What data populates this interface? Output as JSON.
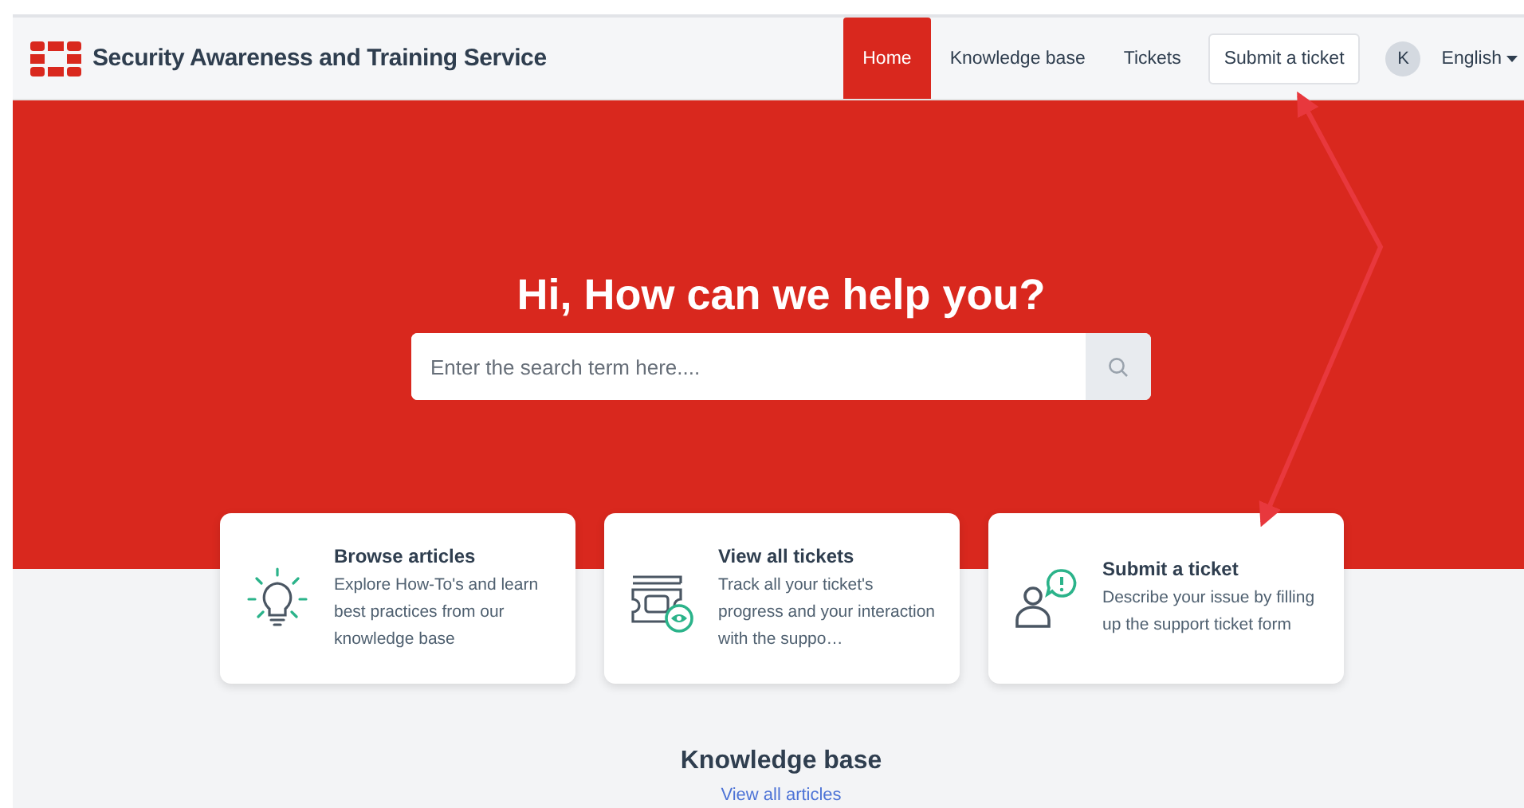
{
  "header": {
    "title": "Security Awareness and Training Service",
    "nav": [
      {
        "label": "Home",
        "kind": "link",
        "selected": true
      },
      {
        "label": "Knowledge base",
        "kind": "link",
        "selected": false
      },
      {
        "label": "Tickets",
        "kind": "link",
        "selected": false
      },
      {
        "label": "Submit a ticket",
        "kind": "button",
        "selected": false
      }
    ],
    "avatar": "K",
    "language": "English"
  },
  "hero": {
    "heading": "Hi, How can we help you?",
    "search": {
      "placeholder": "Enter the search term here...."
    }
  },
  "cards": [
    {
      "kind": "bulb",
      "title": "Browse articles",
      "text": "Explore How-To's and learn best practices from our knowledge base"
    },
    {
      "kind": "tickets",
      "title": "View all tickets",
      "text": "Track all your ticket's progress and your interaction with the suppo…"
    },
    {
      "kind": "person",
      "title": "Submit a ticket",
      "text": "Describe your issue by filling up the support ticket form"
    }
  ],
  "knowledge": {
    "heading": "Knowledge base",
    "link": "View all articles"
  }
}
